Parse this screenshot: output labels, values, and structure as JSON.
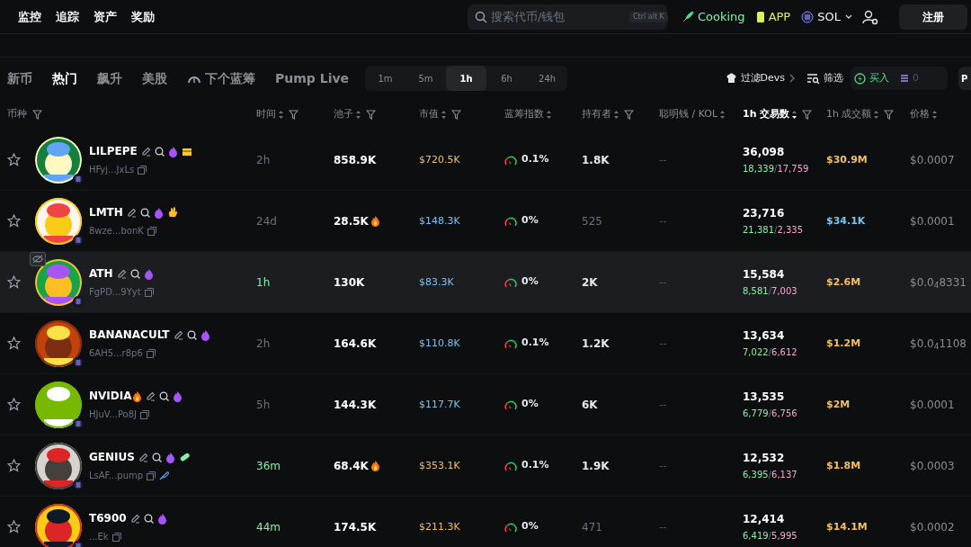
{
  "nav": [
    "监控",
    "追踪",
    "资产",
    "奖励"
  ],
  "search": {
    "placeholder": "搜索代币/钱包",
    "shortcut": "Ctrl alt K"
  },
  "header_links": [
    {
      "kind": "cooking",
      "label": "Cooking"
    },
    {
      "kind": "app",
      "label": "APP"
    },
    {
      "kind": "chain",
      "label": "SOL"
    }
  ],
  "register_button": "注册",
  "tabs": [
    {
      "label": "新币",
      "selected": false
    },
    {
      "label": "热门",
      "selected": true
    },
    {
      "label": "飙升",
      "selected": false
    },
    {
      "label": "美股",
      "selected": false
    },
    {
      "label": "下个蓝筹",
      "selected": false,
      "kind": "gauge"
    },
    {
      "label": "Pump Live",
      "selected": false
    }
  ],
  "intervals": [
    {
      "label": "1m",
      "selected": false
    },
    {
      "label": "5m",
      "selected": false
    },
    {
      "label": "1h",
      "selected": true
    },
    {
      "label": "6h",
      "selected": false
    },
    {
      "label": "24h",
      "selected": false
    }
  ],
  "filter_devs": "过滤Devs",
  "filter": "筛选",
  "buy": {
    "label": "买入",
    "amount": "0"
  },
  "cut_button": "P",
  "columns": [
    {
      "label": "币种",
      "filter": true,
      "sorted": false
    },
    {
      "label": "时间",
      "filter": true,
      "sorted": false
    },
    {
      "label": "池子",
      "filter": true,
      "sorted": false
    },
    {
      "label": "市值",
      "filter": true,
      "sorted": false
    },
    {
      "label": "蓝筹指数",
      "filter": false,
      "sorted": false
    },
    {
      "label": "持有者",
      "filter": true,
      "sorted": false
    },
    {
      "label": "聪明钱 / KOL",
      "filter": false,
      "sorted": false
    },
    {
      "label": "1h 交易数",
      "filter": true,
      "sorted": true
    },
    {
      "label": "1h 成交额",
      "filter": true,
      "sorted": false
    },
    {
      "label": "价格",
      "filter": false,
      "sorted": false
    }
  ],
  "rows": [
    {
      "name": "LILPEPE",
      "name_fire": false,
      "badges": [
        {
          "kind": "box"
        }
      ],
      "address": "HFyj...JxLs",
      "feather": false,
      "hidden_icon": false,
      "highlighted": false,
      "time": "2h",
      "recent": false,
      "pool": "858.9K",
      "pool_fire": false,
      "mcap": {
        "text": "$720.5K",
        "color": "#f0c060"
      },
      "bluechip": "0.1%",
      "holders": "1.8K",
      "holders_dim": false,
      "smart": "--",
      "txns": "36,098",
      "buys": "18,339",
      "separator": "/",
      "sells": "17,759",
      "volume": {
        "text": "$30.9M",
        "color": "#f0c060"
      },
      "price": "$0.0007"
    },
    {
      "name": "LMTH",
      "name_fire": false,
      "badges": [
        {
          "kind": "hand"
        }
      ],
      "address": "8wze...bonK",
      "feather": false,
      "hidden_icon": false,
      "highlighted": false,
      "time": "24d",
      "recent": false,
      "pool": "28.5K",
      "pool_fire": true,
      "mcap": {
        "text": "$148.3K",
        "color": "#7cc4f0"
      },
      "bluechip": "0%",
      "holders": "525",
      "holders_dim": true,
      "smart": "--",
      "txns": "23,716",
      "buys": "21,381",
      "separator": "/",
      "sells": "2,335",
      "volume": {
        "text": "$34.1K",
        "color": "#7cc4f0"
      },
      "price": "$0.0001"
    },
    {
      "name": "ATH",
      "name_fire": false,
      "badges": [],
      "address": "FgPD...9Yyt",
      "feather": false,
      "hidden_icon": true,
      "highlighted": true,
      "time": "1h",
      "recent": true,
      "pool": "130K",
      "pool_fire": false,
      "mcap": {
        "text": "$83.3K",
        "color": "#7cc4f0"
      },
      "bluechip": "0%",
      "holders": "2K",
      "holders_dim": false,
      "smart": "--",
      "txns": "15,584",
      "buys": "8,581",
      "separator": "/",
      "sells": "7,003",
      "volume": {
        "text": "$2.6M",
        "color": "#f0c060"
      },
      "price": "$0.0$_{4}$8331"
    },
    {
      "name": "BANANACULT",
      "name_fire": false,
      "badges": [],
      "address": "6AH5...r8p6",
      "feather": false,
      "hidden_icon": false,
      "highlighted": false,
      "time": "2h",
      "recent": false,
      "pool": "164.6K",
      "pool_fire": false,
      "mcap": {
        "text": "$110.8K",
        "color": "#7cc4f0"
      },
      "bluechip": "0.1%",
      "holders": "1.2K",
      "holders_dim": false,
      "smart": "--",
      "txns": "13,634",
      "buys": "7,022",
      "separator": "/",
      "sells": "6,612",
      "volume": {
        "text": "$1.2M",
        "color": "#f0c060"
      },
      "price": "$0.0$_{4}$1108"
    },
    {
      "name": "NVIDIA",
      "name_fire": true,
      "badges": [],
      "address": "HJuV...Po8J",
      "feather": false,
      "hidden_icon": false,
      "highlighted": false,
      "time": "5h",
      "recent": false,
      "pool": "144.3K",
      "pool_fire": false,
      "mcap": {
        "text": "$117.7K",
        "color": "#7cc4f0"
      },
      "bluechip": "0%",
      "holders": "6K",
      "holders_dim": false,
      "smart": "--",
      "txns": "13,535",
      "buys": "6,779",
      "separator": "/",
      "sells": "6,756",
      "volume": {
        "text": "$2M",
        "color": "#f0c060"
      },
      "price": "$0.0001"
    },
    {
      "name": "GENIUS",
      "name_fire": false,
      "badges": [
        {
          "kind": "pill"
        }
      ],
      "address": "LsAF...pump",
      "feather": true,
      "hidden_icon": false,
      "highlighted": false,
      "time": "36m",
      "recent": true,
      "pool": "68.4K",
      "pool_fire": true,
      "mcap": {
        "text": "$353.1K",
        "color": "#f0c060"
      },
      "bluechip": "0.1%",
      "holders": "1.9K",
      "holders_dim": false,
      "smart": "--",
      "txns": "12,532",
      "buys": "6,395",
      "separator": "/",
      "sells": "6,137",
      "volume": {
        "text": "$1.8M",
        "color": "#f0c060"
      },
      "price": "$0.0003"
    },
    {
      "name": "T6900",
      "name_fire": false,
      "badges": [],
      "address": "...Ek",
      "feather": false,
      "hidden_icon": false,
      "highlighted": false,
      "time": "44m",
      "recent": true,
      "pool": "174.5K",
      "pool_fire": false,
      "mcap": {
        "text": "$211.3K",
        "color": "#f0c060"
      },
      "bluechip": "0%",
      "holders": "471",
      "holders_dim": true,
      "smart": "--",
      "txns": "12,414",
      "buys": "6,419",
      "separator": "/",
      "sells": "5,995",
      "volume": {
        "text": "$14.1M",
        "color": "#f0c060"
      },
      "price": "$0.0002"
    }
  ]
}
